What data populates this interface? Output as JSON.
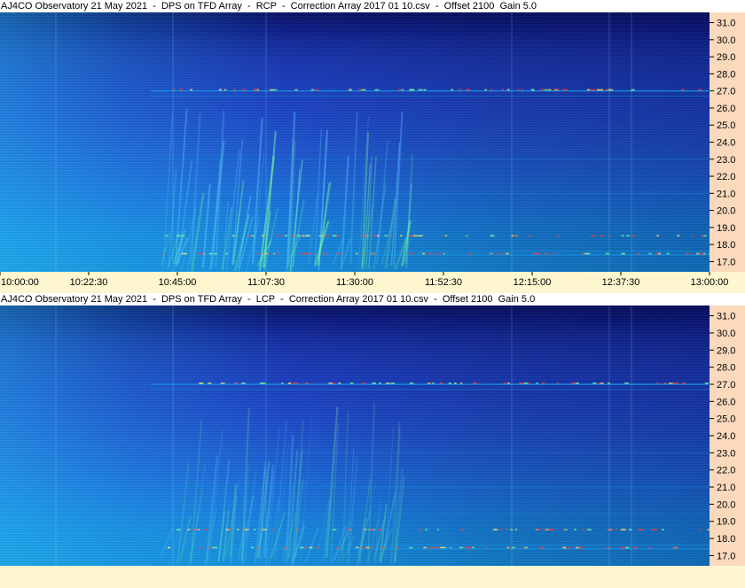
{
  "chart_data": [
    {
      "type": "heatmap",
      "title": "AJ4CO Observatory 21 May 2021  -  DPS on TFD Array  -  RCP  -  Correction Array 2017 01 10.csv  -  Offset 2100  Gain 5.0",
      "xlabel": "",
      "ylabel": "",
      "x_ticks": [
        "10:00:00",
        "10:22:30",
        "10:45:00",
        "11:07:30",
        "11:30:00",
        "11:52:30",
        "12:15:00",
        "12:37:30",
        "13:00:00"
      ],
      "xlim": [
        "10:00:00",
        "13:00:00"
      ],
      "y_ticks": [
        31.0,
        30.0,
        29.0,
        28.0,
        27.0,
        26.0,
        25.0,
        24.0,
        23.0,
        22.0,
        21.0,
        20.0,
        19.0,
        18.0,
        17.0
      ],
      "ylim": [
        16.4,
        31.6
      ],
      "grid": false,
      "colors": {
        "low": "#0a1466",
        "mid": "#1e48c8",
        "high": "#168fdf",
        "burst": "#7dff9a",
        "rfi": "#ff3b3b"
      }
    },
    {
      "type": "heatmap",
      "title": "AJ4CO Observatory 21 May 2021  -  DPS on TFD Array  -  LCP  -  Correction Array 2017 01 10.csv  -  Offset 2100  Gain 5.0",
      "xlabel": "",
      "ylabel": "",
      "x_ticks": [],
      "xlim": [
        "10:00:00",
        "13:00:00"
      ],
      "y_ticks": [
        31.0,
        30.0,
        29.0,
        28.0,
        27.0,
        26.0,
        25.0,
        24.0,
        23.0,
        22.0,
        21.0,
        20.0,
        19.0,
        18.0,
        17.0
      ],
      "ylim": [
        16.4,
        31.6
      ],
      "grid": false,
      "colors": {
        "low": "#0a1466",
        "mid": "#1e48c8",
        "high": "#168fdf",
        "burst": "#7dff9a",
        "rfi": "#ff3b3b"
      }
    }
  ]
}
